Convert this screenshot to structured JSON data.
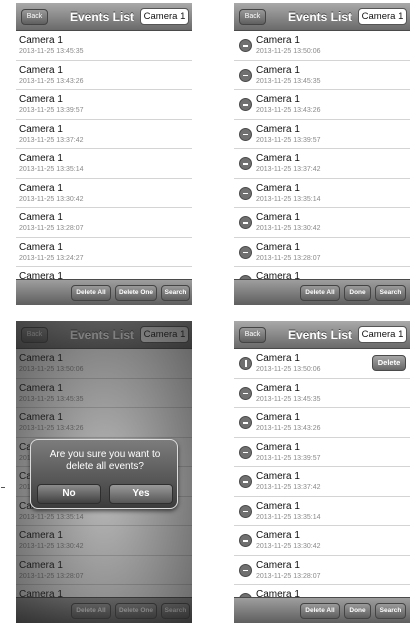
{
  "nav": {
    "back_label": "Back",
    "title": "Events List",
    "camera": "Camera 1"
  },
  "buttons": {
    "delete_all": "Delete All",
    "delete_one": "Delete One",
    "search": "Search",
    "done": "Done",
    "delete": "Delete"
  },
  "screen1_events": [
    {
      "name": "Camera 1",
      "time": "2013-11-25 13:45:35"
    },
    {
      "name": "Camera 1",
      "time": "2013-11-25 13:43:26"
    },
    {
      "name": "Camera 1",
      "time": "2013-11-25 13:39:57"
    },
    {
      "name": "Camera 1",
      "time": "2013-11-25 13:37:42"
    },
    {
      "name": "Camera 1",
      "time": "2013-11-25 13:35:14"
    },
    {
      "name": "Camera 1",
      "time": "2013-11-25 13:30:42"
    },
    {
      "name": "Camera 1",
      "time": "2013-11-25 13:28:07"
    },
    {
      "name": "Camera 1",
      "time": "2013-11-25 13:24:27"
    },
    {
      "name": "Camera 1",
      "time": ""
    }
  ],
  "screen2_events": [
    {
      "name": "Camera 1",
      "time": "2013-11-25 13:50:06"
    },
    {
      "name": "Camera 1",
      "time": "2013-11-25 13:45:35"
    },
    {
      "name": "Camera 1",
      "time": "2013-11-25 13:43:26"
    },
    {
      "name": "Camera 1",
      "time": "2013-11-25 13:39:57"
    },
    {
      "name": "Camera 1",
      "time": "2013-11-25 13:37:42"
    },
    {
      "name": "Camera 1",
      "time": "2013-11-25 13:35:14"
    },
    {
      "name": "Camera 1",
      "time": "2013-11-25 13:30:42"
    },
    {
      "name": "Camera 1",
      "time": "2013-11-25 13:28:07"
    },
    {
      "name": "Camera 1",
      "time": ""
    }
  ],
  "alert": {
    "message": "Are you sure you want to delete all events?",
    "no_label": "No",
    "yes_label": "Yes"
  },
  "icons": {
    "row_delete": "minus-circle-icon",
    "row_delete_active": "delete-confirm-icon"
  },
  "colors": {
    "bar_top": "#a9a9a9",
    "bar_bottom": "#6a6a6a",
    "time_text": "#8a8a8a"
  }
}
